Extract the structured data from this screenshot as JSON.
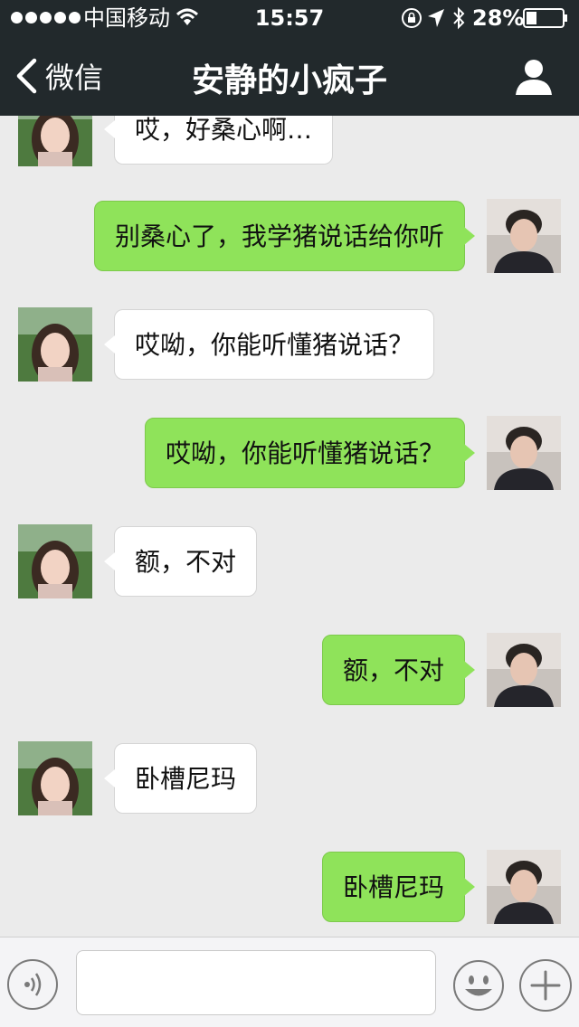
{
  "status_bar": {
    "carrier": "中国移动",
    "time": "15:57",
    "battery": "28%"
  },
  "navbar": {
    "back_label": "微信",
    "title": "安静的小疯子"
  },
  "messages": [
    {
      "sender": "contact",
      "text": "哎，好桑心啊…"
    },
    {
      "sender": "me",
      "text": "别桑心了，我学猪说话给你听"
    },
    {
      "sender": "contact",
      "text": "哎呦，你能听懂猪说话？"
    },
    {
      "sender": "me",
      "text": "哎呦，你能听懂猪说话？"
    },
    {
      "sender": "contact",
      "text": "额，不对"
    },
    {
      "sender": "me",
      "text": "额，不对"
    },
    {
      "sender": "contact",
      "text": "卧槽尼玛"
    },
    {
      "sender": "me",
      "text": "卧槽尼玛"
    }
  ],
  "input": {
    "value": "",
    "placeholder": ""
  },
  "colors": {
    "topbar": "#22292c",
    "chat_background": "#ebebeb",
    "my_bubble": "#8fe35a",
    "contact_bubble": "#ffffff"
  },
  "icons": {
    "back": "chevron-left-icon",
    "profile": "person-icon",
    "voice": "voice-icon",
    "emoji": "smiley-icon",
    "more": "plus-icon"
  }
}
